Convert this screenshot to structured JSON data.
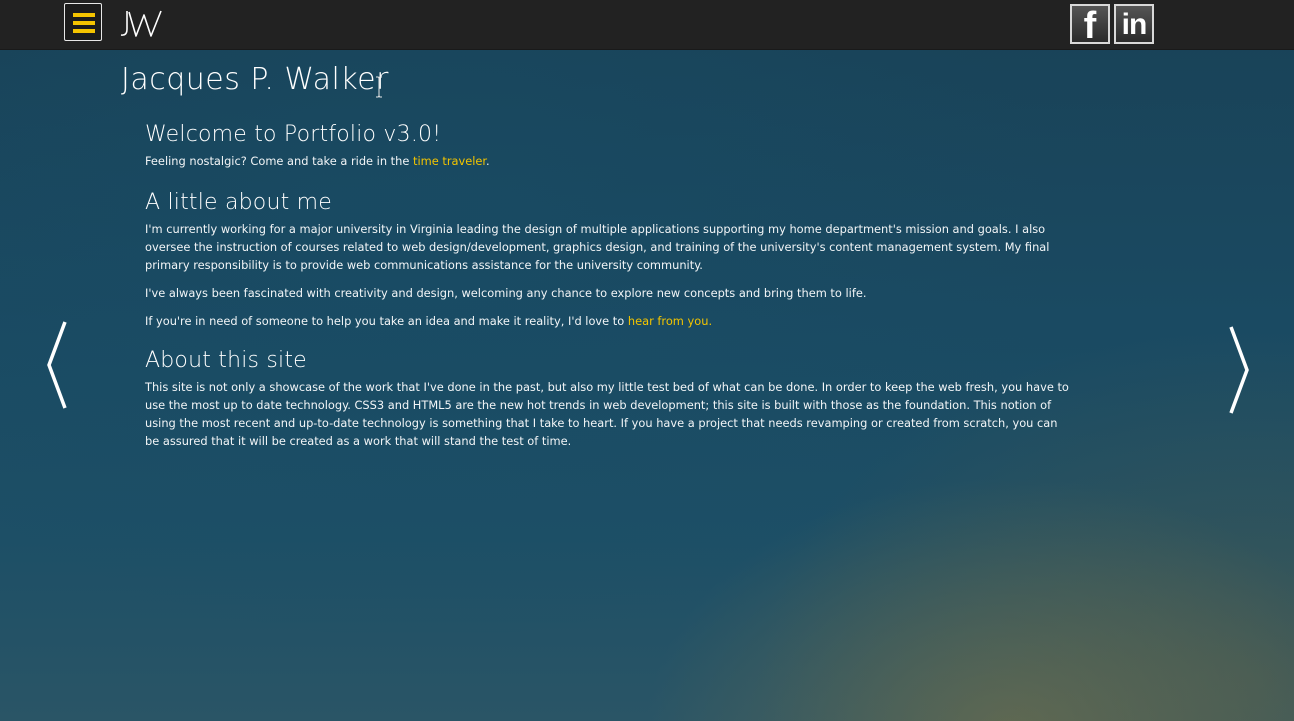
{
  "header": {
    "menu_icon": "hamburger-menu-icon",
    "logo_text": "JW",
    "social": [
      {
        "name": "facebook",
        "glyph": "f"
      },
      {
        "name": "linkedin",
        "glyph": "in"
      }
    ]
  },
  "site_title": "Jacques P. Walker",
  "welcome": {
    "heading": "Welcome to Portfolio v3.0!",
    "text_before": "Feeling nostalgic? Come and take a ride in the ",
    "link": "time traveler",
    "text_after": "."
  },
  "about_me": {
    "heading": "A little about me",
    "paragraph1": "I'm currently working for a major university in Virginia leading the design of multiple applications supporting my home department's mission and goals. I also oversee the instruction of courses related to web design/development, graphics design, and training of the university's content management system. My final primary responsibility is to provide web communications assistance for the university community.",
    "paragraph2": "I've always been fascinated with creativity and design, welcoming any chance to explore new concepts and bring them to life.",
    "paragraph3_before": "If you're in need of someone to help you take an idea and make it reality, I'd love to ",
    "paragraph3_link": "hear from you."
  },
  "about_site": {
    "heading": "About this site",
    "paragraph": "This site is not only a showcase of the work that I've done in the past, but also my little test bed of what can be done. In order to keep the web fresh, you have to use the most up to date technology. CSS3 and HTML5 are the new hot trends in web development; this site is built with those as the foundation. This notion of using the most recent and up-to-date technology is something that I take to heart. If you have a project that needs revamping or created from scratch, you can be assured that it will be created as a work that will stand the test of time."
  },
  "nav": {
    "prev_icon": "chevron-left-icon",
    "next_icon": "chevron-right-icon"
  },
  "colors": {
    "accent": "#f3c400",
    "topbar": "#222222",
    "background": "#1a4a62"
  }
}
